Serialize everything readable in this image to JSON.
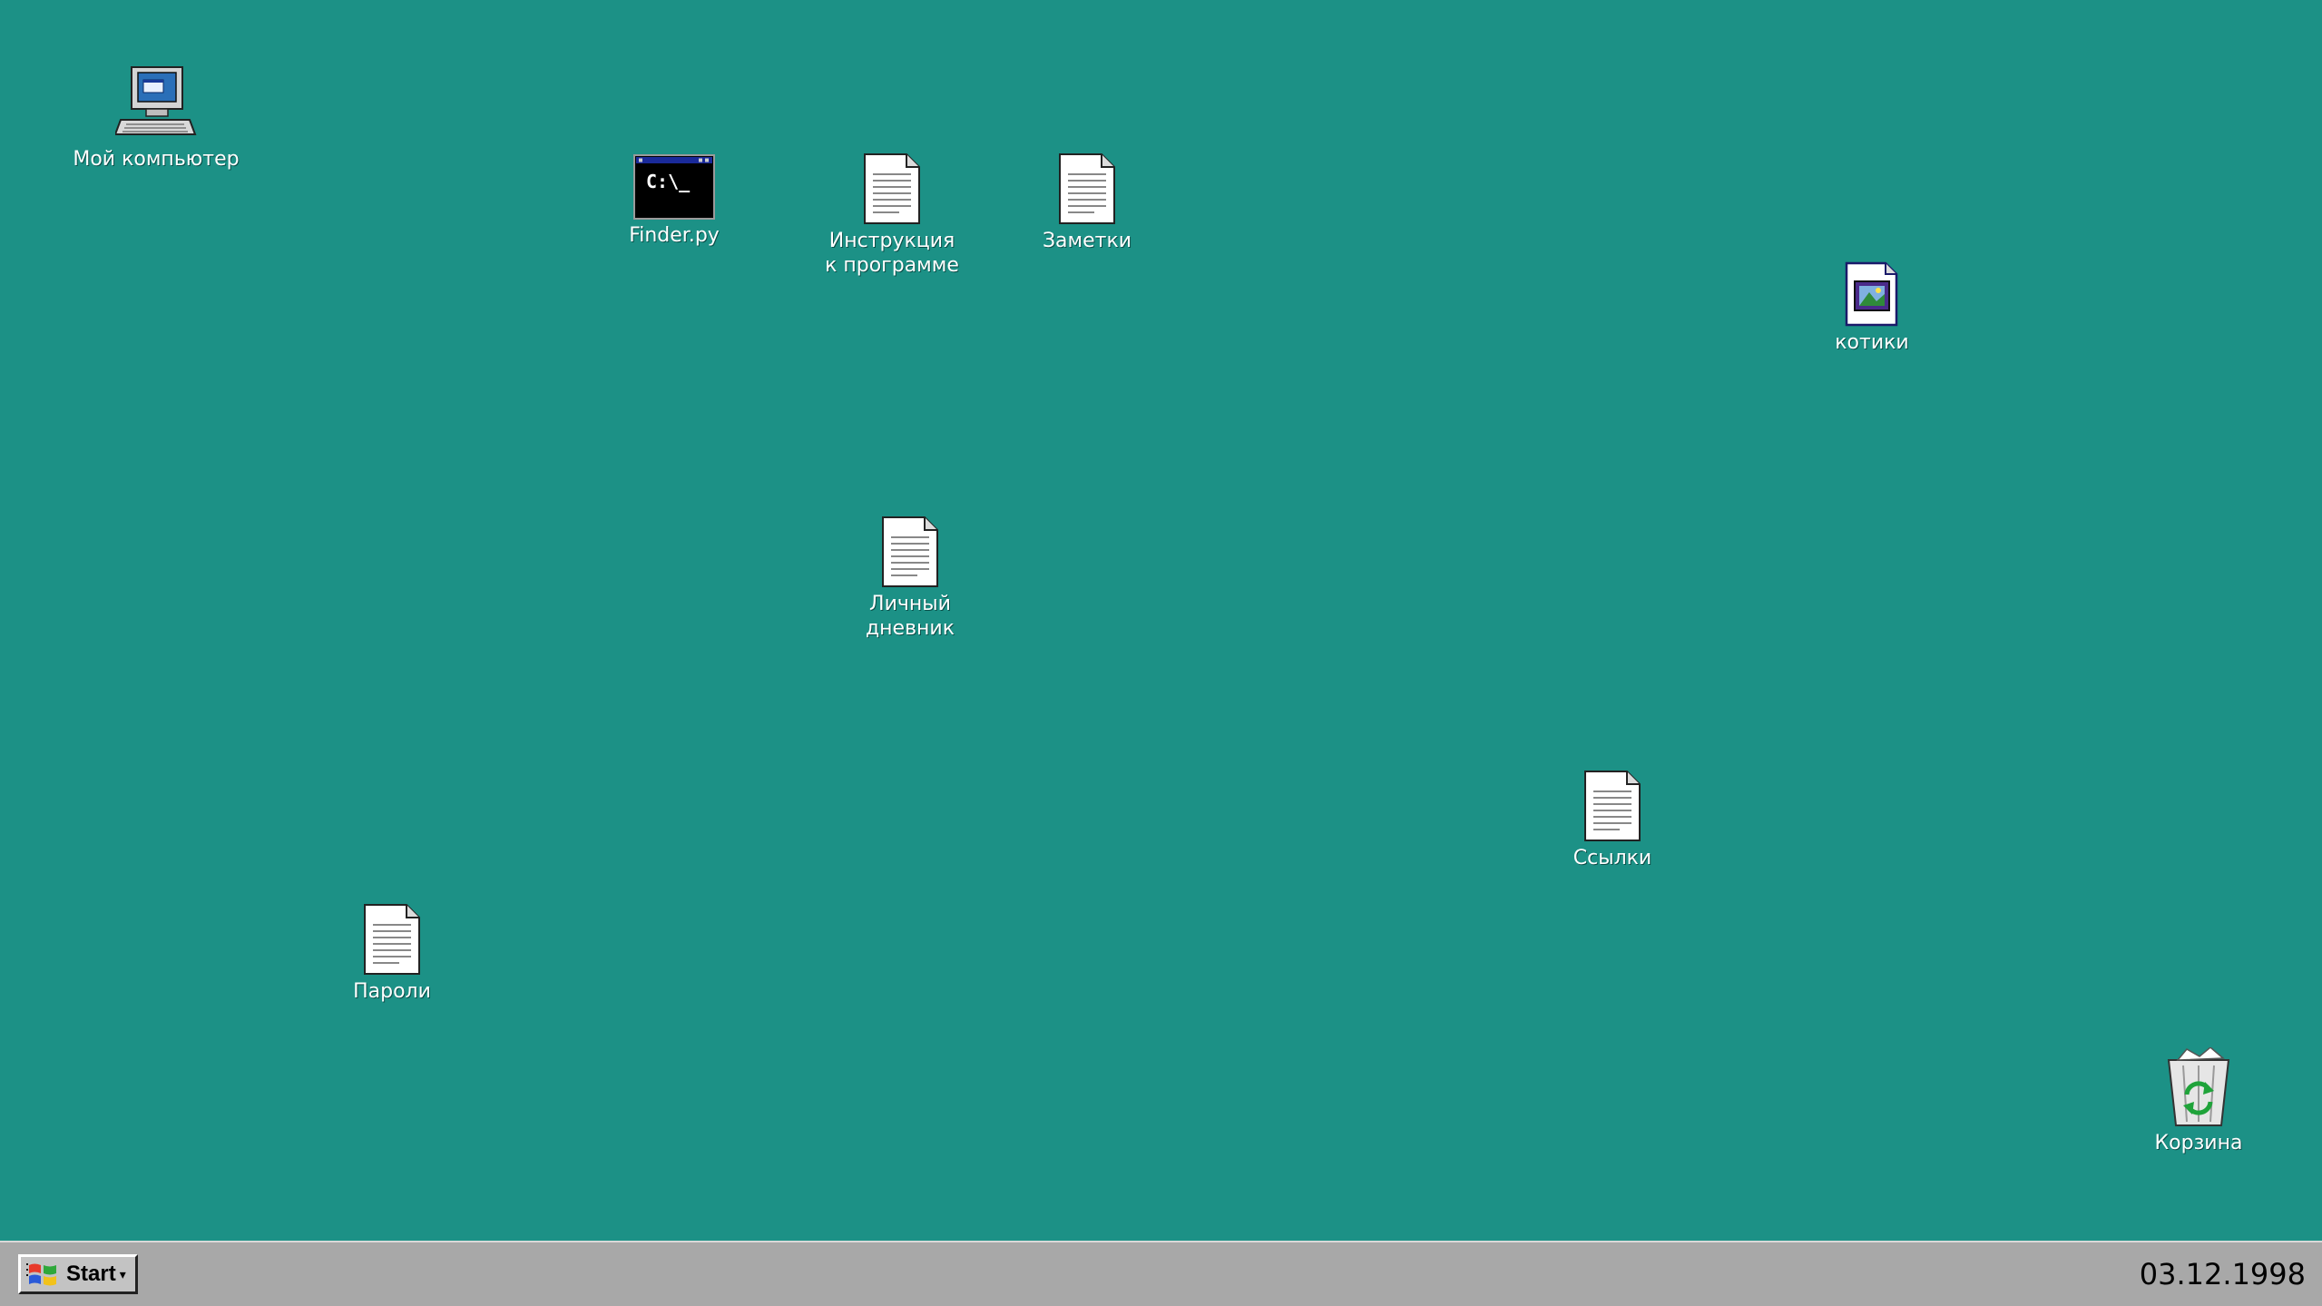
{
  "desktop": {
    "background_color": "#1c9186",
    "icons": {
      "my_computer": {
        "label": "Мой компьютер",
        "icon": "computer-icon"
      },
      "finder_py": {
        "label": "Finder.py",
        "icon": "console-icon",
        "console_text": "C:\\_"
      },
      "instructions": {
        "label": "Инструкция\nк программе",
        "icon": "document-icon"
      },
      "notes": {
        "label": "Заметки",
        "icon": "document-icon"
      },
      "kotiki": {
        "label": "котики",
        "icon": "image-file-icon"
      },
      "diary": {
        "label": "Личный\nдневник",
        "icon": "document-icon"
      },
      "links": {
        "label": "Ссылки",
        "icon": "document-icon"
      },
      "passwords": {
        "label": "Пароли",
        "icon": "document-icon"
      },
      "recycle_bin": {
        "label": "Корзина",
        "icon": "recycle-bin-icon"
      }
    }
  },
  "taskbar": {
    "start_label": "Start",
    "clock": "03.12.1998",
    "background_color": "#a8a8a8"
  }
}
